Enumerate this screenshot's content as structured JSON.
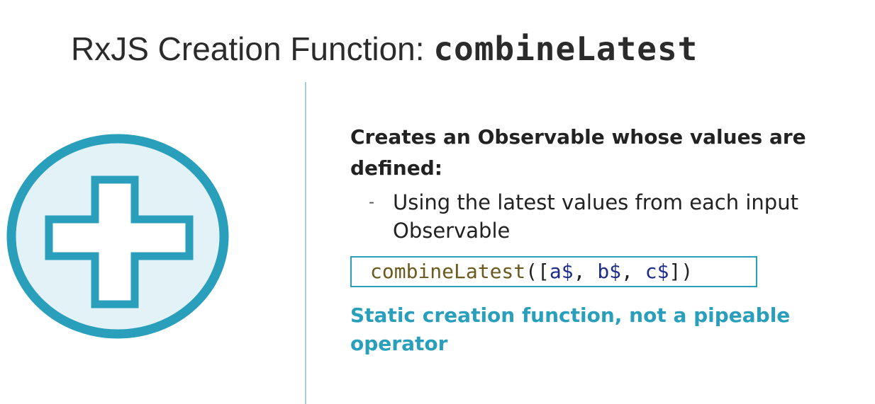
{
  "title": {
    "prefix": "RxJS Creation Function: ",
    "code": "combineLatest"
  },
  "icon": {
    "name": "plus-circle-icon",
    "ring_color": "#2a9fbc",
    "fill_color": "#e3f2f7"
  },
  "content": {
    "heading": "Creates an Observable whose values are defined:",
    "bullet_marker": "-",
    "bullet": "Using the latest values from each input Observable",
    "code": {
      "fn": "combineLatest",
      "open": "([",
      "arg1": "a$",
      "sep1": ", ",
      "arg2": "b$",
      "sep2": ", ",
      "arg3": "c$",
      "close": "])"
    },
    "note": "Static creation function, not a pipeable operator"
  },
  "colors": {
    "accent": "#2a9fbc",
    "divider": "#9fd0dc",
    "text": "#222222"
  }
}
